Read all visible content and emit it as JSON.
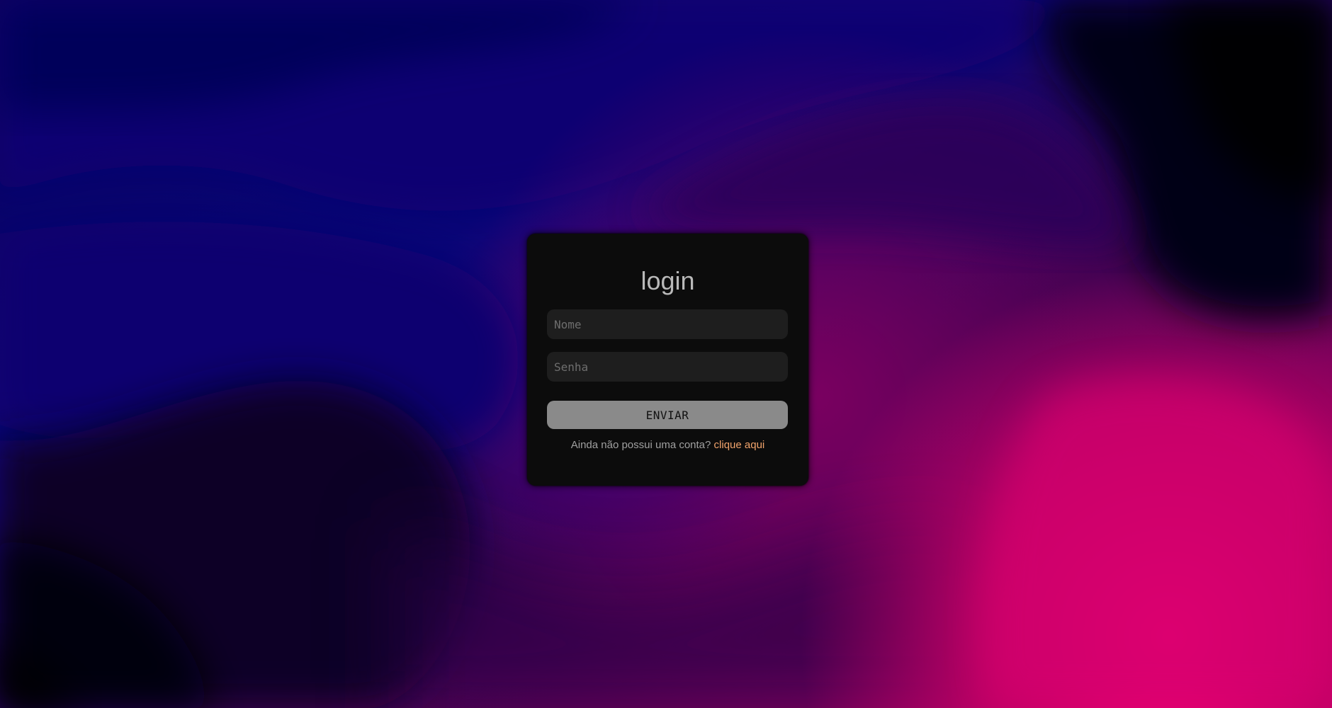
{
  "login": {
    "title": "login",
    "name_placeholder": "Nome",
    "password_placeholder": "Senha",
    "submit_label": "ENVIAR",
    "signup_prompt": "Ainda não possui uma conta?",
    "signup_link": "clique aqui"
  },
  "colors": {
    "card_background": "#0c0c0c",
    "input_background": "#1e1e1e",
    "button_background": "#8a8a8a",
    "link_color": "#f0a36b",
    "title_color": "#b9b9b9"
  }
}
